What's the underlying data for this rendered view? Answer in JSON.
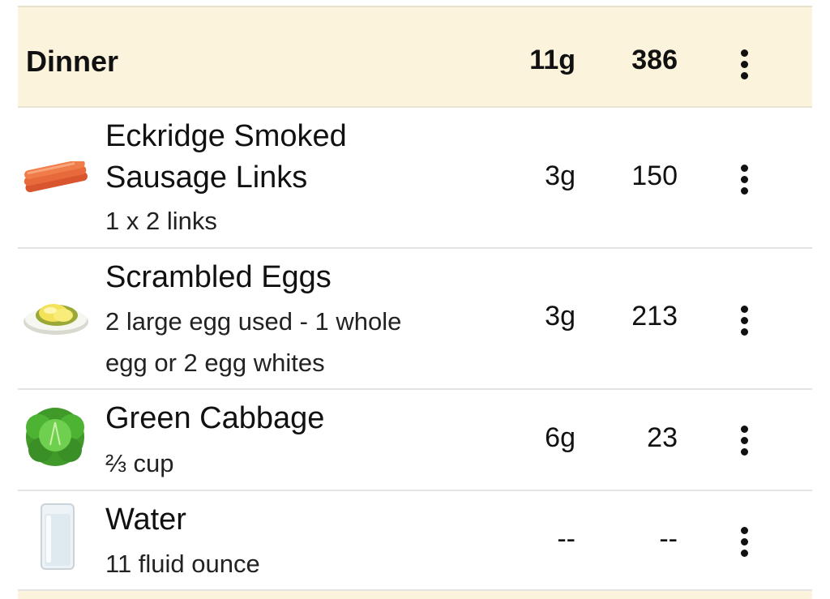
{
  "meal": {
    "title": "Dinner",
    "carbs": "11g",
    "calories": "386"
  },
  "items": [
    {
      "name_line1": "Eckridge Smoked",
      "name_line2": "Sausage Links",
      "serving": "1 x 2 links",
      "carbs": "3g",
      "calories": "150",
      "icon": "sausage-icon"
    },
    {
      "name": "Scrambled Eggs",
      "serving_line1": "2 large egg used - 1 whole",
      "serving_line2": "egg or 2 egg whites",
      "carbs": "3g",
      "calories": "213",
      "icon": "scrambled-eggs-icon"
    },
    {
      "name": "Green Cabbage",
      "serving": "⅔ cup",
      "carbs": "6g",
      "calories": "23",
      "icon": "cabbage-icon"
    },
    {
      "name": "Water",
      "serving": "11 fluid ounce",
      "carbs": "--",
      "calories": "--",
      "icon": "water-glass-icon"
    }
  ]
}
